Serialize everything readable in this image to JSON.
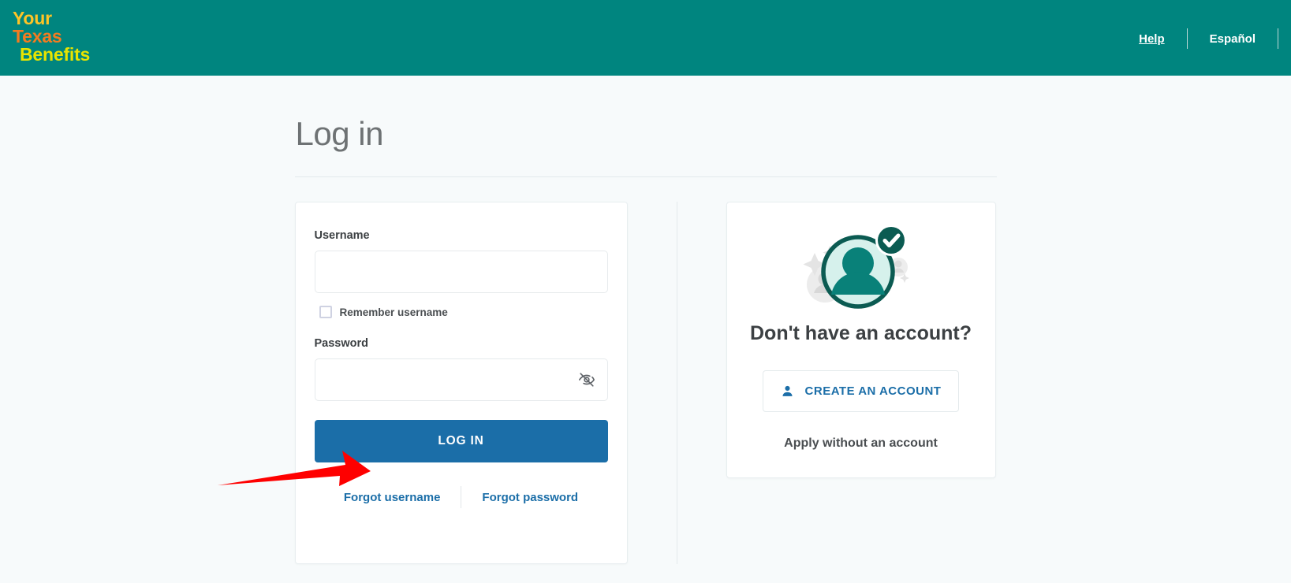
{
  "header": {
    "logo": {
      "line1": "Your",
      "line2": "Texas",
      "line3": "Benefits"
    },
    "nav": [
      {
        "label": "Help",
        "underlined": true
      },
      {
        "label": "Español",
        "underlined": false
      }
    ],
    "bg_color": "#00857f"
  },
  "main": {
    "title": "Log in"
  },
  "login_form": {
    "username_label": "Username",
    "username_value": "",
    "username_placeholder": "",
    "remember_label": "Remember username",
    "remember_checked": false,
    "password_label": "Password",
    "password_value": "",
    "password_placeholder": "",
    "toggle_password_name": "eye-off-icon",
    "submit_label": "LOG IN",
    "submit_color": "#1b6ea8",
    "forgot_username_label": "Forgot username",
    "forgot_password_label": "Forgot password"
  },
  "signup_panel": {
    "heading": "Don't have an account?",
    "create_button_label": "CREATE AN ACCOUNT",
    "apply_link_label": "Apply without an account",
    "accent_color": "#1b6ea8",
    "illustration_color": "#00857f"
  },
  "annotation": {
    "type": "red-arrow",
    "points_to": "LOG IN",
    "color": "#fe0000"
  }
}
